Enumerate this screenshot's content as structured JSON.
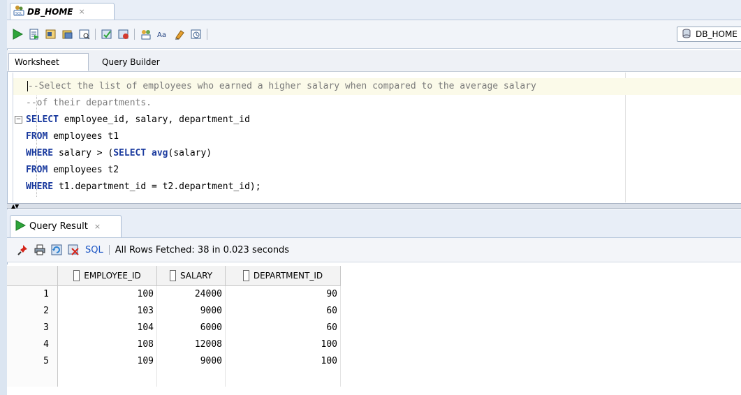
{
  "tab": {
    "title": "DB_HOME",
    "close": "×"
  },
  "connection": {
    "label": "DB_HOME"
  },
  "subtabs": {
    "worksheet": "Worksheet",
    "query_builder": "Query Builder"
  },
  "editor": {
    "lines": [
      {
        "parts": [
          {
            "t": "--Select the list of employees who earned a higher salary when compared to the average salary",
            "k": "cm"
          }
        ]
      },
      {
        "parts": [
          {
            "t": "--of their departments.",
            "k": "cm"
          }
        ]
      },
      {
        "parts": [
          {
            "t": "SELECT",
            "k": "kw"
          },
          {
            "t": " employee_id, salary, department_id",
            "k": ""
          }
        ]
      },
      {
        "parts": [
          {
            "t": "FROM",
            "k": "kw"
          },
          {
            "t": " employees t1",
            "k": ""
          }
        ]
      },
      {
        "parts": [
          {
            "t": "WHERE",
            "k": "kw"
          },
          {
            "t": " salary > (",
            "k": ""
          },
          {
            "t": "SELECT",
            "k": "kw"
          },
          {
            "t": " ",
            "k": ""
          },
          {
            "t": "avg",
            "k": "kw"
          },
          {
            "t": "(salary)",
            "k": ""
          }
        ]
      },
      {
        "parts": [
          {
            "t": "FROM",
            "k": "kw"
          },
          {
            "t": " employees t2",
            "k": ""
          }
        ]
      },
      {
        "parts": [
          {
            "t": "WHERE",
            "k": "kw"
          },
          {
            "t": " t1.department_id = t2.department_id);",
            "k": ""
          }
        ]
      }
    ]
  },
  "result": {
    "tab_label": "Query Result",
    "close": "×",
    "sql_link": "SQL",
    "status": "All Rows Fetched: 38 in 0.023 seconds",
    "columns": [
      "EMPLOYEE_ID",
      "SALARY",
      "DEPARTMENT_ID"
    ],
    "rows": [
      [
        "1",
        "100",
        "24000",
        "90"
      ],
      [
        "2",
        "103",
        "9000",
        "60"
      ],
      [
        "3",
        "104",
        "6000",
        "60"
      ],
      [
        "4",
        "108",
        "12008",
        "100"
      ],
      [
        "5",
        "109",
        "9000",
        "100"
      ]
    ]
  },
  "colors": {
    "keyword": "#1a3a9e",
    "comment": "#7a7a7a",
    "link": "#1c56c5",
    "current_line": "#fbfae9"
  },
  "icons": [
    "sql-worksheet-icon",
    "run-icon",
    "run-script-icon",
    "autotrace-icon",
    "explain-plan-icon",
    "commit-icon",
    "rollback-icon",
    "sql-tuning-icon",
    "to-upper-icon",
    "clear-icon",
    "history-icon",
    "database-icon",
    "pin-icon",
    "print-icon",
    "refresh-icon",
    "cancel-icon"
  ]
}
